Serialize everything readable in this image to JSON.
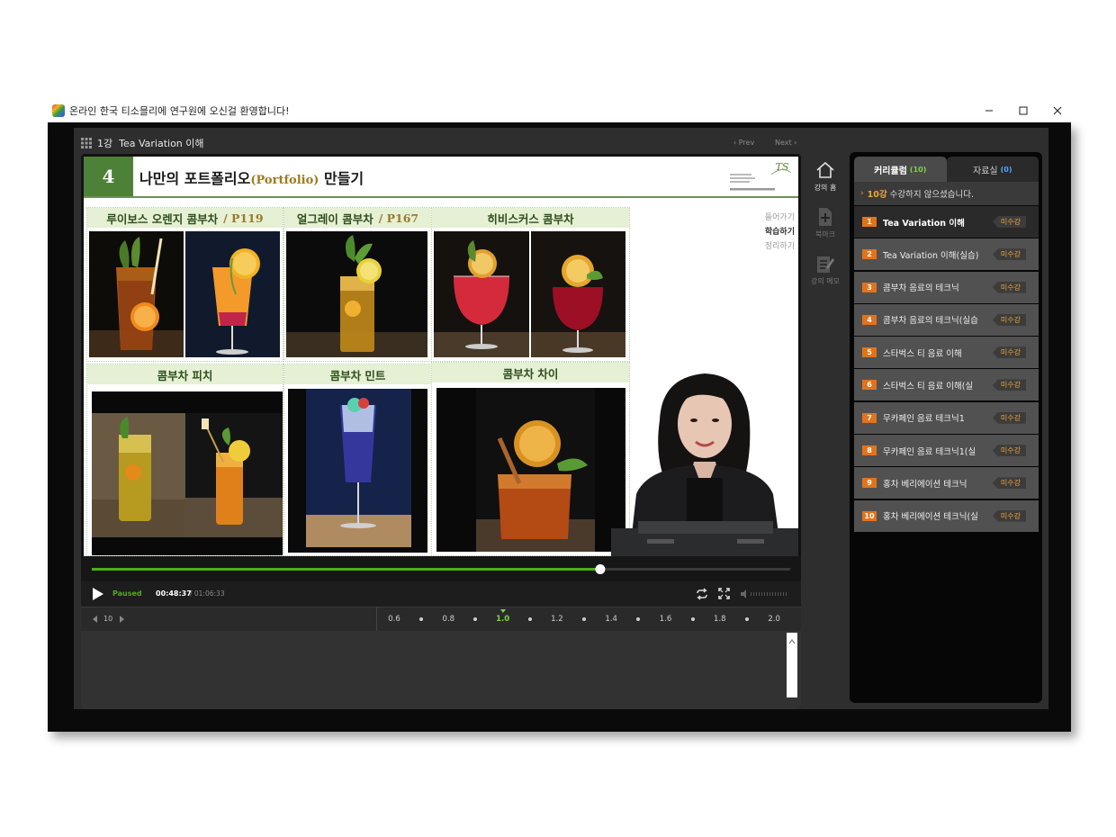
{
  "window": {
    "title": "온라인 한국 티소믈리에 연구원에 오신걸 환영합니다!"
  },
  "player": {
    "lesson_title": "1강  Tea Variation 이해",
    "prev": "‹ Prev",
    "next": "Next ›"
  },
  "slide": {
    "number": "4",
    "title_before": "나만의 포트폴리오",
    "title_accent": "(Portfolio)",
    "title_after": " 만들기",
    "panels": [
      {
        "name": "루이보스 오렌지 콤부차",
        "ref": "/ P119"
      },
      {
        "name": "얼그레이 콤부차",
        "ref": "/ P167"
      },
      {
        "name": "히비스커스 콤부차",
        "ref": ""
      },
      {
        "name": "콤부차 피치",
        "ref": ""
      },
      {
        "name": "콤부차 민트",
        "ref": ""
      },
      {
        "name": "콤부차 차이",
        "ref": ""
      }
    ],
    "steps": [
      "들어가기",
      "학습하기",
      "정리하기"
    ],
    "active_step": "학습하기"
  },
  "playback": {
    "state": "Paused",
    "current_time": "00:48:37",
    "total_time": "/ 01:06:33",
    "progress_fraction": 0.728,
    "skip_seconds": "10",
    "speeds": [
      "0.6",
      "0.8",
      "1.0",
      "1.2",
      "1.4",
      "1.6",
      "1.8",
      "2.0"
    ],
    "selected_speed": "1.0"
  },
  "tools": [
    {
      "icon": "home-icon",
      "label": "강의 홈"
    },
    {
      "icon": "bookmark-add-icon",
      "label": "북마크"
    },
    {
      "icon": "memo-icon",
      "label": "강의 메모"
    }
  ],
  "curriculum": {
    "tab_curriculum": "커리큘럼",
    "tab_curriculum_count": "(10)",
    "tab_materials": "자료실",
    "tab_materials_count": "(0)",
    "notice_count": "10강",
    "notice_text": " 수강하지 않으셨습니다.",
    "lessons": [
      {
        "num": "1",
        "title": "Tea Variation 이해",
        "status": "미수강"
      },
      {
        "num": "2",
        "title": "Tea Variation 이해(실습)",
        "status": "미수강"
      },
      {
        "num": "3",
        "title": "콤부차 음료의 테크닉",
        "status": "미수강"
      },
      {
        "num": "4",
        "title": "콤부차 음료의 테크닉(실습",
        "status": "미수강"
      },
      {
        "num": "5",
        "title": "스타벅스 티 음료 이해",
        "status": "미수강"
      },
      {
        "num": "6",
        "title": "스타벅스 티 음료 이해(실",
        "status": "미수강"
      },
      {
        "num": "7",
        "title": "무카페인 음료 테크닉1",
        "status": "미수강"
      },
      {
        "num": "8",
        "title": "무카페인 음료 테크닉1(실",
        "status": "미수강"
      },
      {
        "num": "9",
        "title": "홍차 베리에이션 테크닉",
        "status": "미수강"
      },
      {
        "num": "10",
        "title": "홍차 베리에이션 테크닉(실",
        "status": "미수강"
      }
    ]
  },
  "colors": {
    "progress": "#4caf1a",
    "speed_active": "#7fd14d",
    "slide_green": "#4e8138",
    "status_orange": "#f0a43a",
    "lesson_badge": "#e2731c"
  }
}
